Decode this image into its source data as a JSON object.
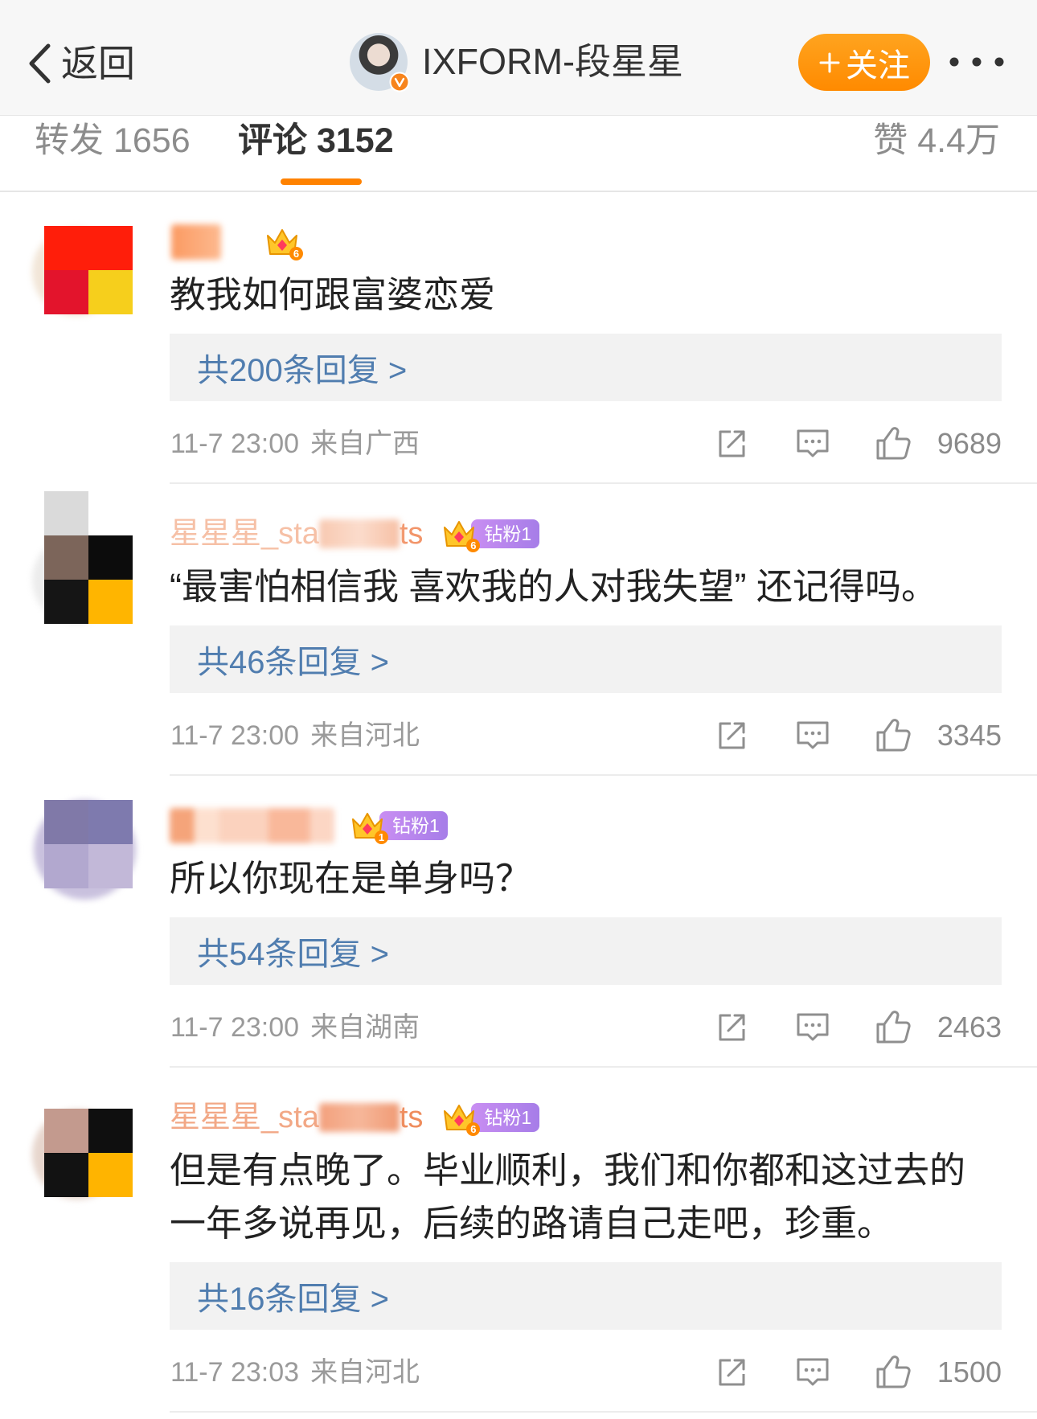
{
  "header": {
    "back_label": "返回",
    "title": "IXFORM-段星星",
    "follow_label": "关注"
  },
  "tabs": {
    "repost": "转发 1656",
    "comments": "评论 3152",
    "likes": "赞 4.4万"
  },
  "colors": {
    "accent": "#ff8200",
    "reply_link": "#507daf",
    "meta_text": "#9a9a9a",
    "fan_badge": "#b383ec",
    "crown": "#ffc62a"
  },
  "comments": [
    {
      "crown_level": "6",
      "text": "教我如何跟富婆恋爱",
      "replies": "共200条回复 >",
      "time": "11-7 23:00",
      "location": "来自广西",
      "likes": "9689",
      "avatar_cells": [
        "#ff1e0a",
        "#ff1e0a",
        "#e3142c",
        "#f6cf1c"
      ]
    },
    {
      "name_start": "星星星_sta",
      "name_end": "ts",
      "crown_level": "6",
      "fan_badge": "钻粉1",
      "text": "“最害怕相信我 喜欢我的人对我失望” 还记得吗。",
      "replies": "共46条回复 >",
      "time": "11-7 23:00",
      "location": "来自河北",
      "likes": "3345",
      "avatar_cells": [
        "#dadada",
        "transparent",
        "#7c655a",
        "#0c0c0c",
        "#151515",
        "#ffb500"
      ]
    },
    {
      "crown_level": "1",
      "fan_badge": "钻粉1",
      "text": "所以你现在是单身吗？",
      "replies": "共54条回复 >",
      "time": "11-7 23:00",
      "location": "来自湖南",
      "likes": "2463",
      "avatar_cells": [
        "#8079a8",
        "#7e7aae",
        "#b2a8cf",
        "#c2b8d8"
      ]
    },
    {
      "name_start": "星星星_sta",
      "name_end": "ts",
      "crown_level": "6",
      "fan_badge": "钻粉1",
      "text": "但是有点晚了。毕业顺利，我们和你都和这过去的一年多说再见，后续的路请自己走吧，珍重。",
      "replies": "共16条回复 >",
      "time": "11-7 23:03",
      "location": "来自河北",
      "likes": "1500",
      "avatar_cells": [
        "#c39a8e",
        "#0f0f0f",
        "#121212",
        "#ffb400"
      ]
    }
  ]
}
